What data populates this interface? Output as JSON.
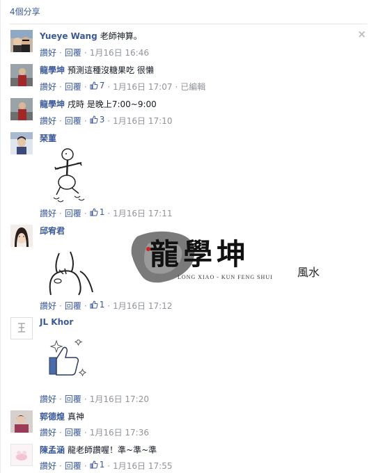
{
  "shares": "4個分享",
  "close_symbol": "×",
  "actions": {
    "like": "讚好",
    "reply": "回覆",
    "sep": "·"
  },
  "comments": [
    {
      "author": "Yueye Wang",
      "text": "老師神算。",
      "likes": "",
      "time": "1月16日 16:46",
      "edited": ""
    },
    {
      "author": "龍學坤",
      "text": "預測這種沒糖果吃 很懶",
      "likes": "7",
      "time": "1月16日 17:07",
      "edited": "已編輯"
    },
    {
      "author": "龍學坤",
      "text": "戌時 是晚上7:00~9:00",
      "likes": "3",
      "time": "1月16日 17:10",
      "edited": ""
    },
    {
      "author": "琹菫",
      "text": "",
      "likes": "1",
      "time": "1月16日 17:11",
      "edited": ""
    },
    {
      "author": "邱宥君",
      "text": "",
      "likes": "1",
      "time": "1月16日 17:12",
      "edited": ""
    },
    {
      "author": "JL Khor",
      "text": "",
      "likes": "",
      "time": "1月16日 17:20",
      "edited": ""
    },
    {
      "author": "郭德煌",
      "text": "真神",
      "likes": "",
      "time": "1月16日 17:36",
      "edited": ""
    },
    {
      "author": "陳孟涵",
      "text": "龍老師讚喔！準~準~準",
      "likes": "1",
      "time": "1月16日 17:55",
      "edited": ""
    }
  ],
  "watermark": {
    "title": "龍學坤",
    "subtitle": "LONG XIAO - KUN  FENG SHUI",
    "script": "風水"
  },
  "colors": {
    "link": "#3b5998",
    "muted": "#90949c",
    "text": "#141823"
  }
}
